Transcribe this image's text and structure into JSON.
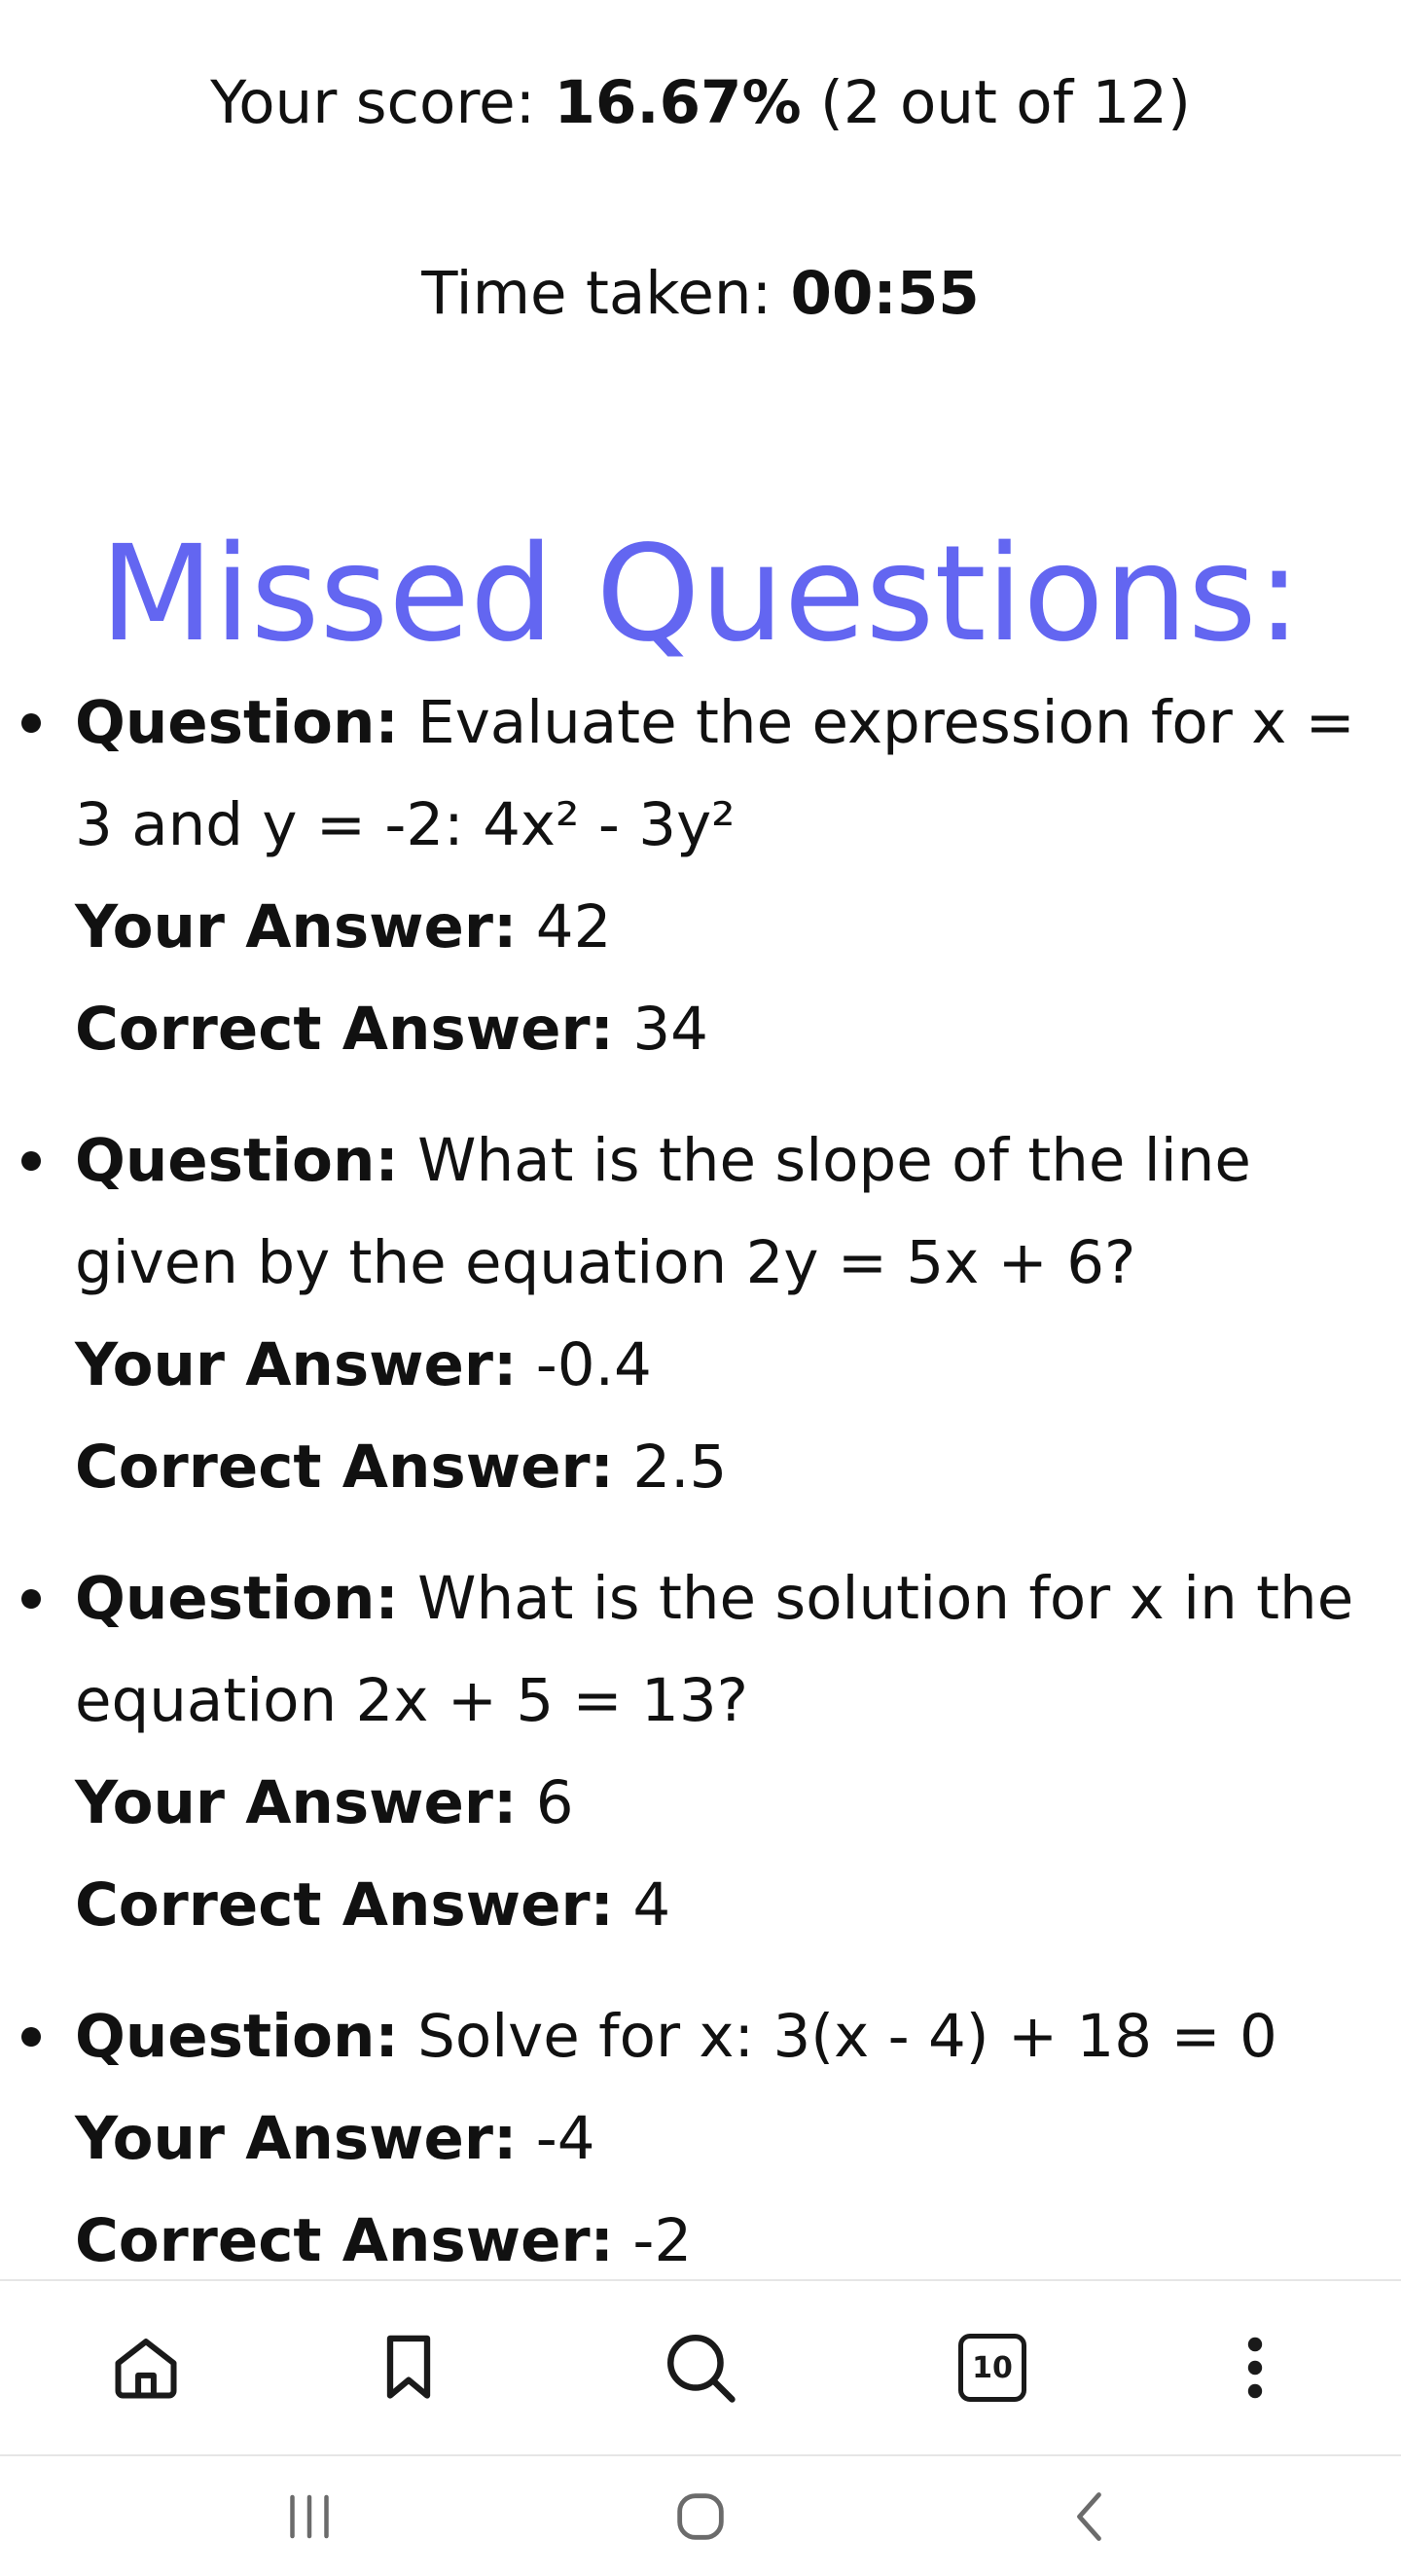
{
  "results": {
    "score_prefix": "Your score: ",
    "score_value": "16.67%",
    "score_suffix": " (2 out of 12)",
    "time_prefix": "Time taken: ",
    "time_value": "00:55"
  },
  "missed": {
    "title": "Missed Questions:",
    "question_label": "Question:",
    "your_answer_label": "Your Answer:",
    "correct_answer_label": "Correct Answer:",
    "items": [
      {
        "question": "Evaluate the expression for x = 3 and y = -2: 4x² - 3y²",
        "your_answer": "42",
        "correct_answer": "34"
      },
      {
        "question": "What is the slope of the line given by the equation 2y = 5x + 6?",
        "your_answer": "-0.4",
        "correct_answer": "2.5"
      },
      {
        "question": "What is the solution for x in the equation 2x + 5 = 13?",
        "your_answer": "6",
        "correct_answer": "4"
      },
      {
        "question": "Solve for x: 3(x - 4) + 18 = 0",
        "your_answer": "-4",
        "correct_answer": "-2"
      }
    ]
  },
  "browser_toolbar": {
    "tab_count": "10",
    "icons": [
      "home-icon",
      "bookmark-icon",
      "search-icon",
      "tabs-icon",
      "more-options-icon"
    ]
  },
  "system_nav": {
    "icons": [
      "recent-apps-icon",
      "home-circle-icon",
      "back-icon"
    ]
  },
  "colors": {
    "title_accent": "#6366f1",
    "text": "#111111"
  }
}
